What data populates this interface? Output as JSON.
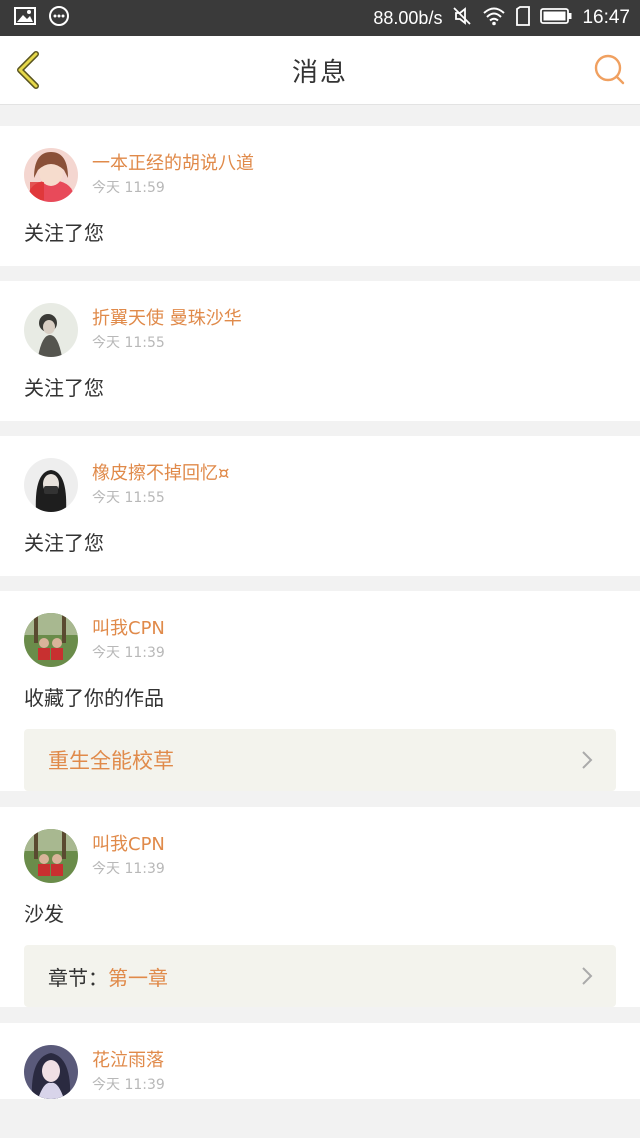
{
  "status_bar": {
    "speed": "88.00b/s",
    "time": "16:47"
  },
  "nav": {
    "title": "消息"
  },
  "accent_color": "#e08a4a",
  "messages": [
    {
      "user": "一本正经的胡说八道",
      "time": "今天 11:59",
      "action": "关注了您"
    },
    {
      "user": "折翼天使 曼珠沙华",
      "time": "今天 11:55",
      "action": "关注了您"
    },
    {
      "user": "橡皮擦不掉回忆¤",
      "time": "今天 11:55",
      "action": "关注了您"
    },
    {
      "user": "叫我CPN",
      "time": "今天 11:39",
      "action": "收藏了你的作品",
      "link": "重生全能校草"
    },
    {
      "user": "叫我CPN",
      "time": "今天 11:39",
      "action": "沙发",
      "link_prefix": "章节：",
      "link_value": "第一章"
    },
    {
      "user": "花泣雨落",
      "time": "今天 11:39"
    }
  ]
}
